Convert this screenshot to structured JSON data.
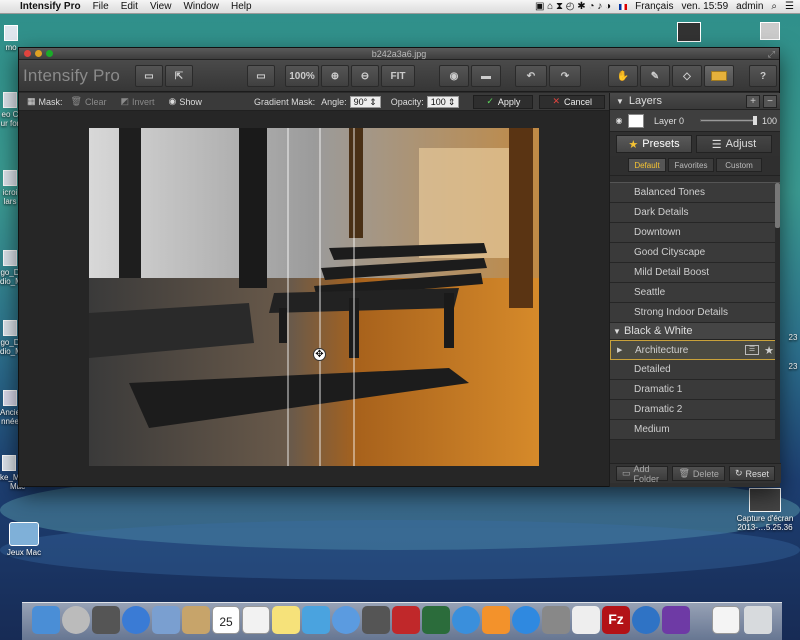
{
  "menubar": {
    "app": "Intensify Pro",
    "menus": [
      "File",
      "Edit",
      "View",
      "Window",
      "Help"
    ],
    "lang": "Français",
    "clock": "ven. 15:59",
    "user": "admin"
  },
  "desktop": {
    "labels": [
      "mo",
      "eo C",
      "ur for",
      "icroi",
      "lars",
      "go_D",
      "dio_M",
      "go_D",
      "dio_M",
      "Ancie",
      "nnée",
      "ke_Mortimer_",
      "Mac",
      "Jeux Mac",
      "Capture d'écran",
      "2013-…5.25.36",
      "23",
      "23"
    ]
  },
  "window": {
    "title": "b242a3a6.jpg"
  },
  "toolbar": {
    "brand": "Intensify Pro",
    "zoom": "100%",
    "fit": "FIT"
  },
  "maskbar": {
    "mask": "Mask:",
    "clear": "Clear",
    "invert": "Invert",
    "show": "Show",
    "gradient": "Gradient Mask:",
    "angle_label": "Angle:",
    "angle": "90°",
    "opacity_label": "Opacity:",
    "opacity": "100",
    "apply": "Apply",
    "cancel": "Cancel"
  },
  "layers": {
    "title": "Layers",
    "layer": "Layer 0",
    "value": "100",
    "opacity_fraction": 1.0
  },
  "tabs": {
    "presets": "Presets",
    "adjust": "Adjust",
    "sub": [
      "Default",
      "Favorites",
      "Custom"
    ]
  },
  "presets": {
    "items": [
      "Balanced Tones",
      "Dark Details",
      "Downtown",
      "Good Cityscape",
      "Mild Detail Boost",
      "Seattle",
      "Strong Indoor Details"
    ],
    "section": "Black & White",
    "bw": [
      "Architecture",
      "Detailed",
      "Dramatic 1",
      "Dramatic 2",
      "Medium"
    ]
  },
  "panelfoot": {
    "add": "Add Folder",
    "delete": "Delete",
    "reset": "Reset"
  },
  "colors": {
    "accent": "#f5c333",
    "selected": "#4a4a42"
  }
}
